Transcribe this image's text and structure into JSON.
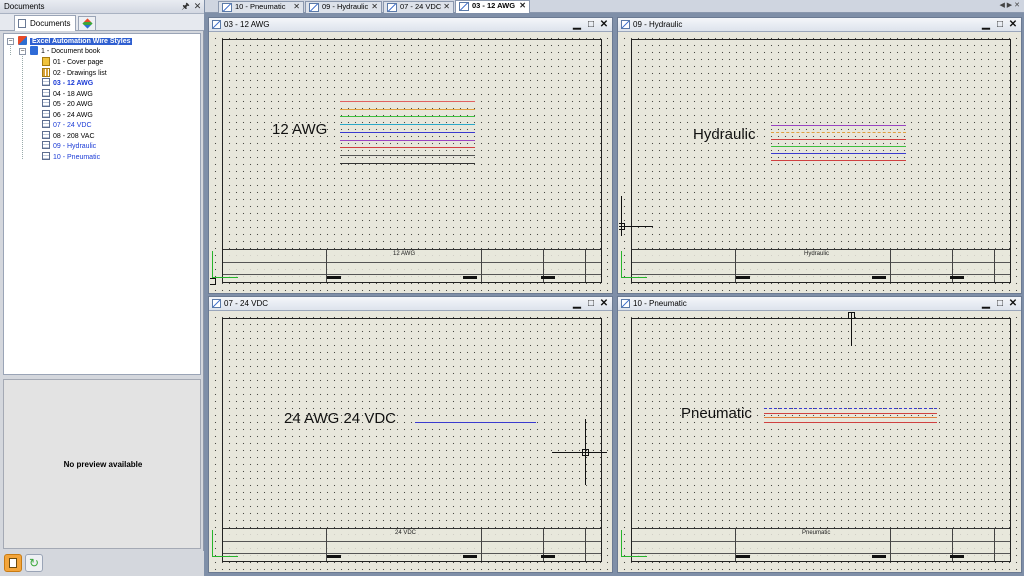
{
  "docs_panel": {
    "title": "Documents",
    "tab_label": "Documents",
    "preview_text": "No preview available"
  },
  "tree": {
    "project": "Excel Automation Wire Styles",
    "book": "1 - Document book",
    "folios": [
      {
        "label": "01 - Cover page",
        "style": "normal"
      },
      {
        "label": "02 - Drawings list",
        "style": "normal"
      },
      {
        "label": "03 - 12 AWG",
        "style": "blue-bold"
      },
      {
        "label": "04 - 18 AWG",
        "style": "normal"
      },
      {
        "label": "05 - 20 AWG",
        "style": "normal"
      },
      {
        "label": "06 - 24 AWG",
        "style": "normal"
      },
      {
        "label": "07 - 24 VDC",
        "style": "blue"
      },
      {
        "label": "08 - 208 VAC",
        "style": "normal"
      },
      {
        "label": "09 - Hydraulic",
        "style": "blue"
      },
      {
        "label": "10 - Pneumatic",
        "style": "blue"
      }
    ]
  },
  "doc_tabs": [
    {
      "label": "10 - Pneumatic",
      "active": false
    },
    {
      "label": "09 - Hydraulic",
      "active": false
    },
    {
      "label": "07 - 24 VDC",
      "active": false
    },
    {
      "label": "03 - 12 AWG",
      "active": true
    }
  ],
  "viewports": [
    {
      "title": "03 - 12 AWG",
      "label": "12 AWG",
      "titleblock_name": "12 AWG",
      "wires": [
        {
          "color": "#e06060",
          "style": "solid"
        },
        {
          "color": "#e0a040",
          "style": "solid"
        },
        {
          "color": "#3fbf3f",
          "style": "solid"
        },
        {
          "color": "#2aa8c8",
          "style": "solid"
        },
        {
          "color": "#3a3acf",
          "style": "solid"
        },
        {
          "color": "#9a45c2",
          "style": "solid"
        },
        {
          "color": "#d04040",
          "style": "solid"
        },
        {
          "color": "#555555",
          "style": "solid"
        },
        {
          "color": "#333333",
          "style": "solid"
        }
      ]
    },
    {
      "title": "09 - Hydraulic",
      "label": "Hydraulic",
      "titleblock_name": "Hydraulic",
      "wires": [
        {
          "color": "#9a45c2",
          "style": "solid"
        },
        {
          "color": "#e0a040",
          "style": "dashed"
        },
        {
          "color": "#d04040",
          "style": "solid"
        },
        {
          "color": "#3fbf3f",
          "style": "solid"
        },
        {
          "color": "#3a3acf",
          "style": "solid"
        },
        {
          "color": "#d04040",
          "style": "solid"
        }
      ]
    },
    {
      "title": "07 - 24 VDC",
      "label": "24 AWG 24 VDC",
      "titleblock_name": "24 VDC",
      "wires": [
        {
          "color": "#3a3acf",
          "style": "solid"
        }
      ]
    },
    {
      "title": "10 - Pneumatic",
      "label": "Pneumatic",
      "titleblock_name": "Pneumatic",
      "wires": [
        {
          "color": "#3a3acf",
          "style": "dashed"
        },
        {
          "color": "#d04040",
          "style": "solid"
        },
        {
          "color": "#e08040",
          "style": "solid"
        },
        {
          "color": "#d04040",
          "style": "solid"
        }
      ]
    }
  ]
}
